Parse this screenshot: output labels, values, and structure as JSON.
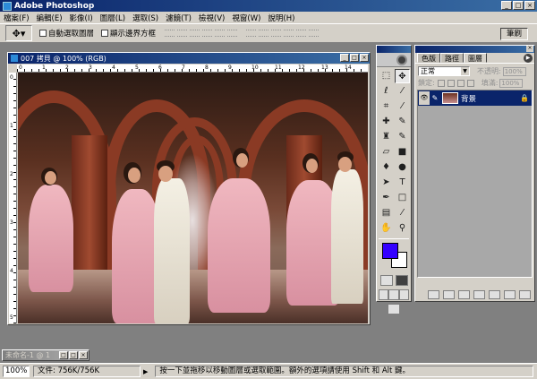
{
  "app": {
    "title": "Adobe Photoshop",
    "window_buttons": [
      "_",
      "□",
      "×"
    ]
  },
  "menu": {
    "items": [
      "檔案(F)",
      "編輯(E)",
      "影像(I)",
      "圖層(L)",
      "選取(S)",
      "濾鏡(T)",
      "檢視(V)",
      "視窗(W)",
      "說明(H)"
    ]
  },
  "options": {
    "tool_icon": "move-tool-icon",
    "auto_select_label": "自動選取圖層",
    "show_bounds_label": "顯示邊界方框",
    "brushes_tab_label": "筆刷"
  },
  "document": {
    "title": "007 拷貝 @ 100% (RGB)",
    "ruler_marks_h": [
      "0",
      "1",
      "2",
      "3",
      "4",
      "5",
      "6",
      "7",
      "8",
      "9",
      "10",
      "11",
      "12",
      "13",
      "14"
    ],
    "ruler_marks_v": [
      "0",
      "1",
      "2",
      "3",
      "4",
      "5"
    ]
  },
  "minimized": {
    "title": "未命名-1 @ 1"
  },
  "toolbox": {
    "tools": [
      "marquee-icon",
      "move-icon",
      "lasso-icon",
      "magic-wand-icon",
      "crop-icon",
      "slice-icon",
      "healing-brush-icon",
      "brush-icon",
      "stamp-icon",
      "history-brush-icon",
      "eraser-icon",
      "gradient-icon",
      "blur-icon",
      "dodge-icon",
      "path-select-icon",
      "type-icon",
      "pen-icon",
      "shape-icon",
      "notes-icon",
      "eyedropper-icon",
      "hand-icon",
      "zoom-icon"
    ],
    "foreground_color": "#3300ff",
    "background_color": "#ffffff"
  },
  "layers_palette": {
    "tabs": [
      "色版",
      "路徑",
      "圖層"
    ],
    "active_tab": "圖層",
    "blend_mode": "正常",
    "opacity_label": "不透明:",
    "opacity_value": "100%",
    "lock_label": "鎖定:",
    "fill_label": "填滿:",
    "fill_value": "100%",
    "layers": [
      {
        "name": "背景",
        "visible": true,
        "locked": true
      }
    ]
  },
  "status": {
    "zoom": "100%",
    "doc_info": "文件: 756K/756K",
    "message": "按一下並拖移以移動圖層或選取範圍。額外的選項請使用 Shift 和 Alt 鍵。"
  }
}
